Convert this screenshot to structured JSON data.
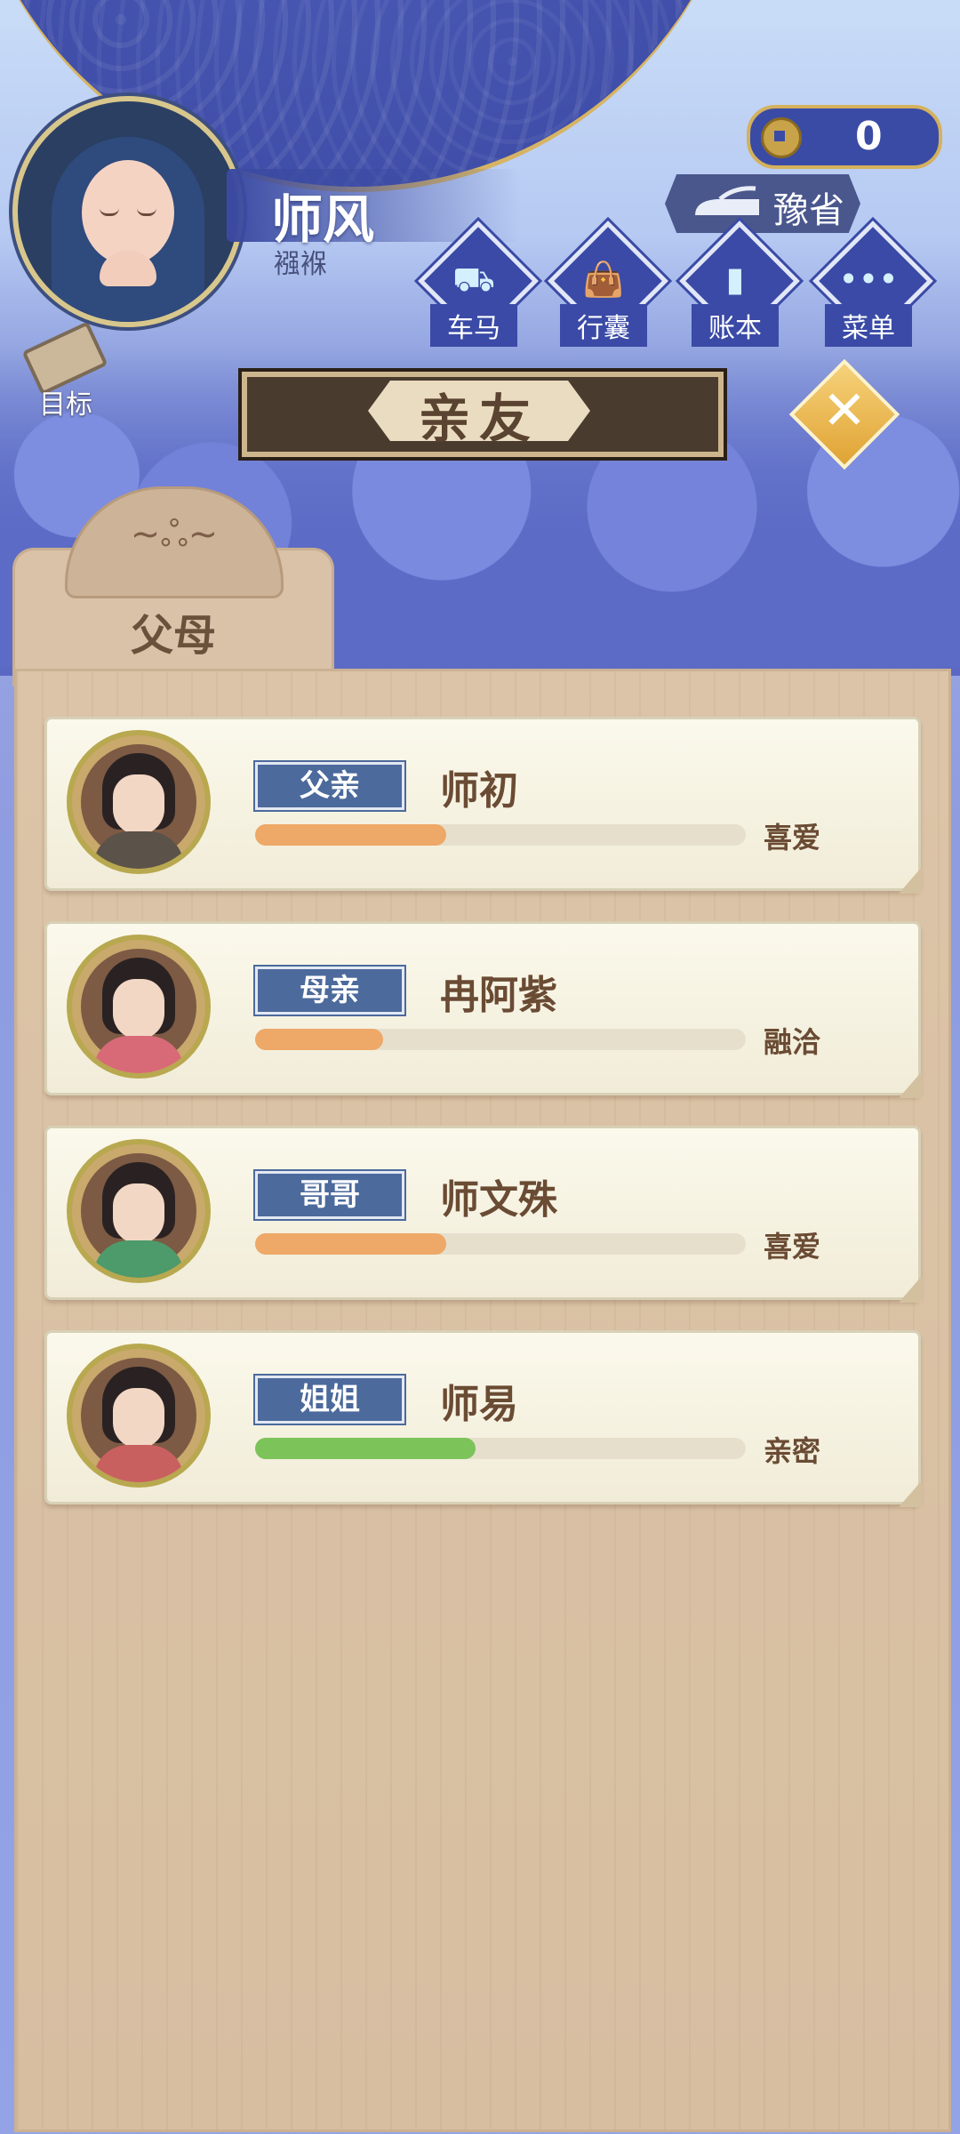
{
  "header": {
    "player_name": "师风",
    "player_status": "襁褓",
    "coins": "0",
    "region": "豫省",
    "goal_label": "目标"
  },
  "menu": [
    {
      "label": "车马",
      "icon": "carriage-icon"
    },
    {
      "label": "行囊",
      "icon": "bag-icon"
    },
    {
      "label": "账本",
      "icon": "ledger-icon"
    },
    {
      "label": "菜单",
      "icon": "more-icon"
    }
  ],
  "title": "亲友",
  "tab": {
    "label": "父母"
  },
  "relatives": [
    {
      "relation": "父亲",
      "name": "师初",
      "affinity": "喜爱",
      "affinity_fraction": 0.39,
      "bar_color": "#eea867",
      "robe_color": "#5b5249"
    },
    {
      "relation": "母亲",
      "name": "冉阿紫",
      "affinity": "融洽",
      "affinity_fraction": 0.26,
      "bar_color": "#eea867",
      "robe_color": "#d86a78"
    },
    {
      "relation": "哥哥",
      "name": "师文殊",
      "affinity": "喜爱",
      "affinity_fraction": 0.39,
      "bar_color": "#eea867",
      "robe_color": "#4d9a6a"
    },
    {
      "relation": "姐姐",
      "name": "师易",
      "affinity": "亲密",
      "affinity_fraction": 0.45,
      "bar_color": "#7cc35a",
      "robe_color": "#c96060"
    }
  ],
  "colors": {
    "panel": "#d9c2a8",
    "card": "#f7f3e2",
    "tag": "#4c6a9c",
    "accent_gold": "#d4b15c"
  }
}
